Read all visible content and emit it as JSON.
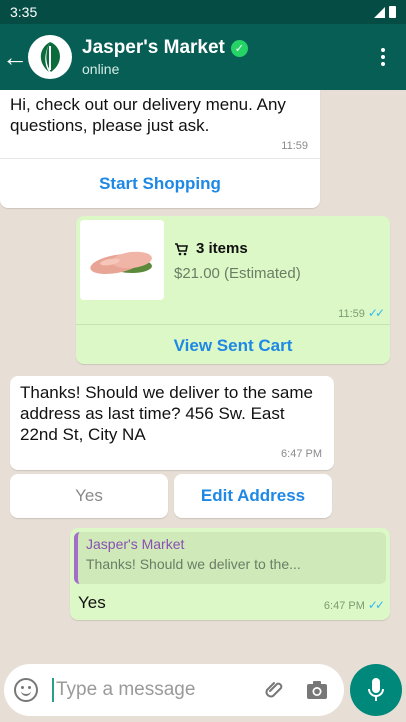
{
  "status": {
    "time": "3:35"
  },
  "header": {
    "back_icon": "arrow-left-icon",
    "title": "Jasper's Market",
    "subtitle": "online",
    "verified_icon": "verified-check-icon",
    "menu_icon": "more-vertical-icon"
  },
  "messages": {
    "welcome": {
      "text": "Hi, check out our delivery menu. Any questions, please just ask.",
      "time": "11:59",
      "button": "Start Shopping"
    },
    "cart": {
      "items": "3 items",
      "price": "$21.00 (Estimated)",
      "time": "11:59",
      "button": "View Sent Cart"
    },
    "delivery": {
      "text": "Thanks! Should we deliver to the same address as last time? 456 Sw. East 22nd St, City NA",
      "time": "6:47 PM"
    },
    "quick_replies": [
      "Yes",
      "Edit Address"
    ],
    "reply": {
      "quote_name": "Jasper's Market",
      "quote_text": "Thanks! Should we deliver to the...",
      "text": "Yes",
      "time": "6:47 PM"
    }
  },
  "composer": {
    "placeholder": "Type a message"
  },
  "colors": {
    "header": "#075e54",
    "outgoing": "#dcf8c6",
    "link": "#1e88e5",
    "mic": "#00897b"
  }
}
